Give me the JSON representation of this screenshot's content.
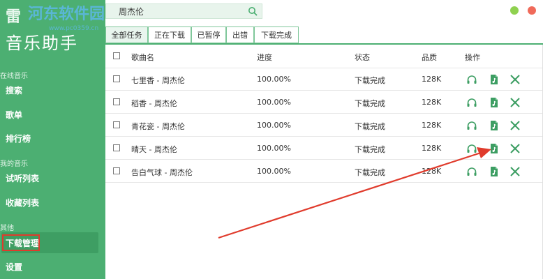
{
  "app": {
    "logo_line1": "雷",
    "logo_line2": "音乐助手",
    "watermark_text": "河东软件园",
    "watermark_url": "www.pc0359.cn"
  },
  "sidebar": {
    "sections": [
      {
        "label": "在线音乐",
        "items": [
          "搜索",
          "歌单",
          "排行榜"
        ]
      },
      {
        "label": "我的音乐",
        "items": [
          "试听列表",
          "收藏列表"
        ]
      },
      {
        "label": "其他",
        "items": [
          "下载管理",
          "设置"
        ]
      }
    ],
    "active_item": "下载管理"
  },
  "search": {
    "value": "周杰伦"
  },
  "window": {
    "colors": {
      "dot1": "#8fd14f",
      "dot2": "#f06a5a"
    }
  },
  "tabs": [
    "全部任务",
    "正在下载",
    "已暂停",
    "出错",
    "下载完成"
  ],
  "active_tab": "全部任务",
  "table": {
    "headers": [
      "歌曲名",
      "进度",
      "状态",
      "品质",
      "操作"
    ],
    "rows": [
      {
        "name": "七里香 - 周杰伦",
        "progress": "100.00%",
        "status": "下载完成",
        "quality": "128K"
      },
      {
        "name": "稻香 - 周杰伦",
        "progress": "100.00%",
        "status": "下载完成",
        "quality": "128K"
      },
      {
        "name": "青花瓷 - 周杰伦",
        "progress": "100.00%",
        "status": "下载完成",
        "quality": "128K"
      },
      {
        "name": "晴天 - 周杰伦",
        "progress": "100.00%",
        "status": "下载完成",
        "quality": "128K"
      },
      {
        "name": "告白气球 - 周杰伦",
        "progress": "100.00%",
        "status": "下载完成",
        "quality": "128K"
      }
    ],
    "row_icons": [
      "headphones-icon",
      "music-file-icon",
      "close-icon"
    ]
  },
  "colors": {
    "accent": "#4caf72",
    "annotation": "#e03b2c"
  }
}
